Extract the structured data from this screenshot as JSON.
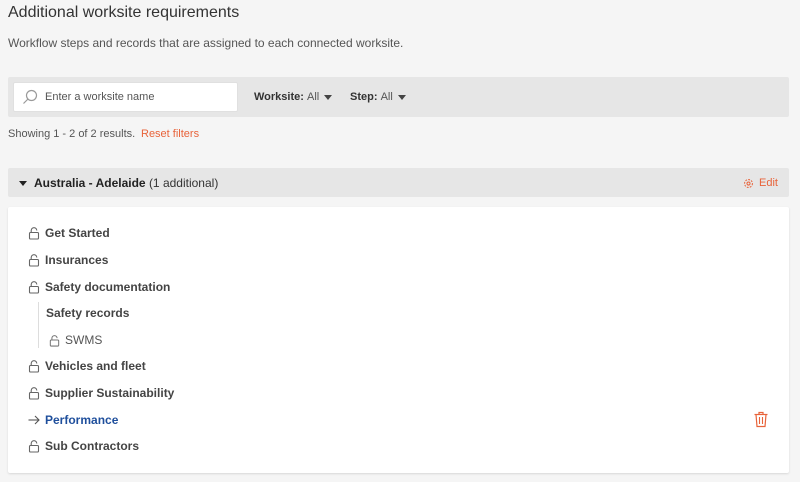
{
  "page": {
    "title": "Additional worksite requirements",
    "subtitle": "Workflow steps and records that are assigned to each connected worksite."
  },
  "filters": {
    "search_placeholder": "Enter a worksite name",
    "search_value": "",
    "worksite_label": "Worksite:",
    "worksite_value": "All",
    "step_label": "Step:",
    "step_value": "All"
  },
  "results": {
    "text": "Showing 1 - 2 of 2 results.",
    "reset_label": "Reset filters"
  },
  "group": {
    "name": "Australia - Adelaide",
    "count": "(1 additional)",
    "edit_label": "Edit"
  },
  "steps": [
    {
      "label": "Get Started",
      "icon": "lock-icon"
    },
    {
      "label": "Insurances",
      "icon": "lock-icon"
    },
    {
      "label": "Safety documentation",
      "icon": "lock-icon"
    },
    {
      "label": "Vehicles and fleet",
      "icon": "lock-icon"
    },
    {
      "label": "Supplier Sustainability",
      "icon": "lock-icon"
    },
    {
      "label": "Performance",
      "icon": "arrow-right-icon"
    },
    {
      "label": "Sub Contractors",
      "icon": "lock-icon"
    }
  ],
  "subsection": {
    "title": "Safety records",
    "items": [
      {
        "label": "SWMS",
        "icon": "lock-icon"
      }
    ]
  },
  "colors": {
    "accent": "#e8633a",
    "active_link": "#1f4f9c"
  }
}
